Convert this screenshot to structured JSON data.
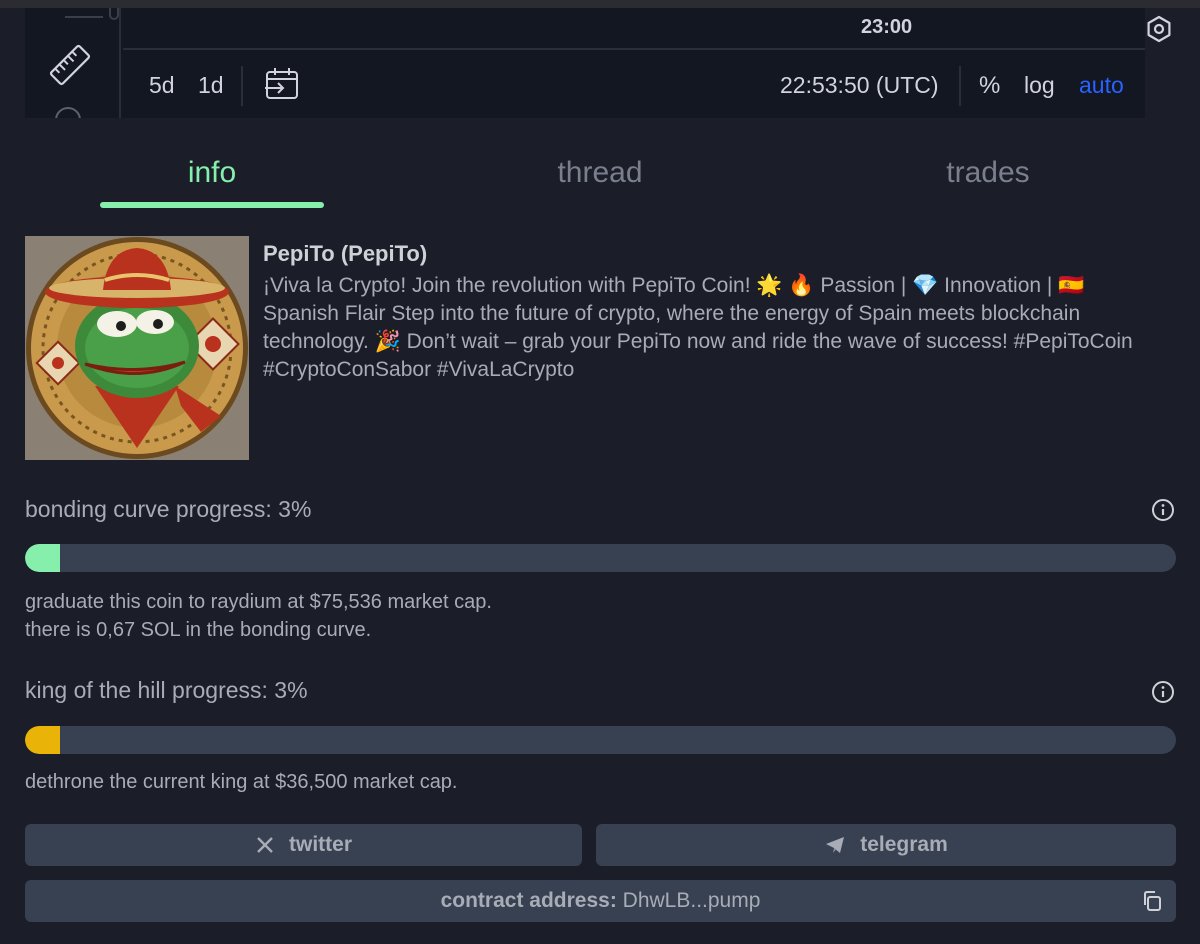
{
  "chart_toolbar": {
    "time_label": "23:00",
    "ranges": [
      "5d",
      "1d"
    ],
    "clock": "22:53:50 (UTC)",
    "percent_label": "%",
    "log_label": "log",
    "auto_label": "auto"
  },
  "tabs": [
    {
      "label": "info",
      "active": true
    },
    {
      "label": "thread",
      "active": false
    },
    {
      "label": "trades",
      "active": false
    }
  ],
  "token": {
    "title": "PepiTo (PepiTo)",
    "description": "¡Viva la Crypto! Join the revolution with PepiTo Coin! 🌟 🔥 Passion | 💎 Innovation | 🇪🇸 Spanish Flair Step into the future of crypto, where the energy of Spain meets blockchain technology. 🎉 Don’t wait – grab your PepiTo now and ride the wave of success! #PepiToCoin #CryptoConSabor #VivaLaCrypto"
  },
  "bonding": {
    "label": "bonding curve progress: 3%",
    "progress_percent": 3,
    "note1": "graduate this coin to raydium at $75,536 market cap.",
    "note2": "there is 0,67 SOL in the bonding curve."
  },
  "koth": {
    "label": "king of the hill progress: 3%",
    "progress_percent": 3,
    "note": "dethrone the current king at $36,500 market cap."
  },
  "links": {
    "twitter": "twitter",
    "telegram": "telegram"
  },
  "contract": {
    "label": "contract address:",
    "value": "DhwLB...pump"
  },
  "colors": {
    "accent_green": "#86efac",
    "accent_yellow": "#eab308",
    "accent_blue": "#2962ff"
  }
}
